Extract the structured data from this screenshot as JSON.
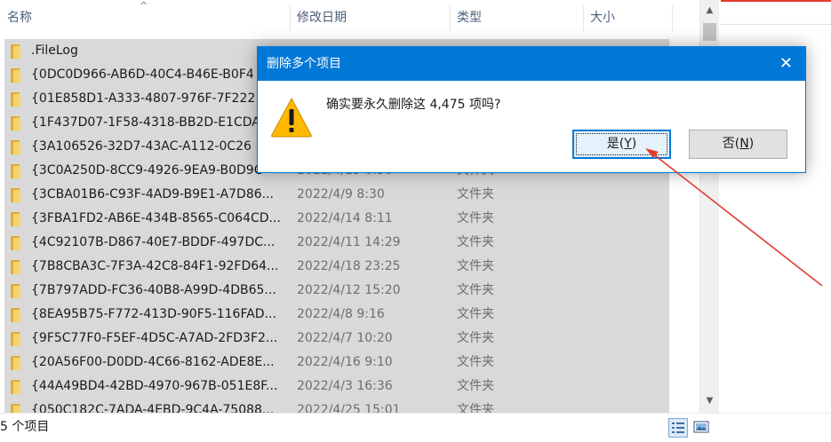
{
  "columns": {
    "name": "名称",
    "date_modified": "修改日期",
    "type": "类型",
    "size": "大小",
    "sort_indicator": "^"
  },
  "files": [
    {
      "name": ".FileLog",
      "date": "",
      "type": ""
    },
    {
      "name": "{0DC0D966-AB6D-40C4-B46E-B0F4",
      "date": "",
      "type": ""
    },
    {
      "name": "{01E858D1-A333-4807-976F-7F222",
      "date": "",
      "type": ""
    },
    {
      "name": "{1F437D07-1F58-4318-BB2D-E1CDA",
      "date": "",
      "type": ""
    },
    {
      "name": "{3A106526-32D7-43AC-A112-0C26",
      "date": "",
      "type": ""
    },
    {
      "name": "{3C0A250D-8CC9-4926-9EA9-B0D9C",
      "date": "2022/4/15 6:30",
      "type": "文件夹"
    },
    {
      "name": "{3CBA01B6-C93F-4AD9-B9E1-A7D86...",
      "date": "2022/4/9 8:30",
      "type": "文件夹"
    },
    {
      "name": "{3FBA1FD2-AB6E-434B-8565-C064CD...",
      "date": "2022/4/14 8:11",
      "type": "文件夹"
    },
    {
      "name": "{4C92107B-D867-40E7-BDDF-497DC...",
      "date": "2022/4/11 14:29",
      "type": "文件夹"
    },
    {
      "name": "{7B8CBA3C-7F3A-42C8-84F1-92FD64...",
      "date": "2022/4/18 23:25",
      "type": "文件夹"
    },
    {
      "name": "{7B797ADD-FC36-40B8-A99D-4DB65...",
      "date": "2022/4/12 15:20",
      "type": "文件夹"
    },
    {
      "name": "{8EA95B75-F772-413D-90F5-116FAD...",
      "date": "2022/4/8 9:16",
      "type": "文件夹"
    },
    {
      "name": "{9F5C77F0-F5EF-4D5C-A7AD-2FD3F2...",
      "date": "2022/4/7 10:20",
      "type": "文件夹"
    },
    {
      "name": "{20A56F00-D0DD-4C66-8162-ADE8E...",
      "date": "2022/4/16 9:10",
      "type": "文件夹"
    },
    {
      "name": "{44A49BD4-42BD-4970-967B-051E8F...",
      "date": "2022/4/3 16:36",
      "type": "文件夹"
    },
    {
      "name": "{050C182C-7ADA-4EBD-9C4A-75088...",
      "date": "2022/4/25 15:01",
      "type": "文件夹"
    }
  ],
  "status_bar": {
    "item_count": "5 个项目"
  },
  "dialog": {
    "title": "删除多个项目",
    "close_glyph": "✕",
    "message": "确实要永久删除这 4,475 项吗?",
    "yes_label": "是(",
    "yes_key": "Y",
    "yes_close": ")",
    "no_label": "否(",
    "no_key": "N",
    "no_close": ")"
  },
  "icons": {
    "folder": "folder-icon",
    "warning": "warning-icon",
    "close": "close-icon",
    "details_view": "details-view-icon",
    "large_icons_view": "large-icons-view-icon"
  },
  "colors": {
    "accent": "#0078d7",
    "selection": "#d9d9d9",
    "folder": "#f7d567",
    "warning": "#ffb900",
    "annotation": "#e33b2e"
  }
}
